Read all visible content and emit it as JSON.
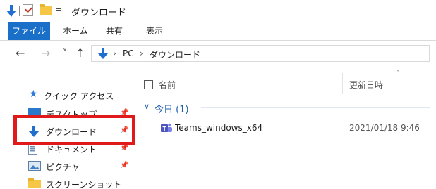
{
  "window": {
    "title": "ダウンロード",
    "qat_dropdown": "="
  },
  "ribbon": {
    "tabs": [
      {
        "label": "ファイル"
      },
      {
        "label": "ホーム"
      },
      {
        "label": "共有"
      },
      {
        "label": "表示"
      }
    ]
  },
  "address": {
    "back": "←",
    "forward": "→",
    "recent": "˅",
    "up": "↑",
    "sep": "›",
    "crumbs": [
      "PC",
      "ダウンロード"
    ]
  },
  "nav_pane": {
    "quick_access": "クイック アクセス",
    "items": [
      {
        "label": "デスクトップ",
        "icon": "desktop-icon",
        "pinned": true
      },
      {
        "label": "ダウンロード",
        "icon": "download-icon",
        "pinned": true
      },
      {
        "label": "ドキュメント",
        "icon": "document-icon",
        "pinned": true
      },
      {
        "label": "ピクチャ",
        "icon": "picture-icon",
        "pinned": true
      },
      {
        "label": "スクリーンショット",
        "icon": "folder-icon",
        "pinned": false
      }
    ],
    "highlight_color": "#e0191b"
  },
  "content": {
    "columns": {
      "name": "名前",
      "date": "更新日時",
      "sort_glyph": "ˇ"
    },
    "group": {
      "chevron": "∨",
      "label": "今日 (1)"
    },
    "files": [
      {
        "name": "Teams_windows_x64",
        "date": "2021/01/18 9:46",
        "icon": "teams-icon"
      }
    ]
  },
  "colors": {
    "accent": "#1a6fc9",
    "group_text": "#1f5fb0"
  }
}
